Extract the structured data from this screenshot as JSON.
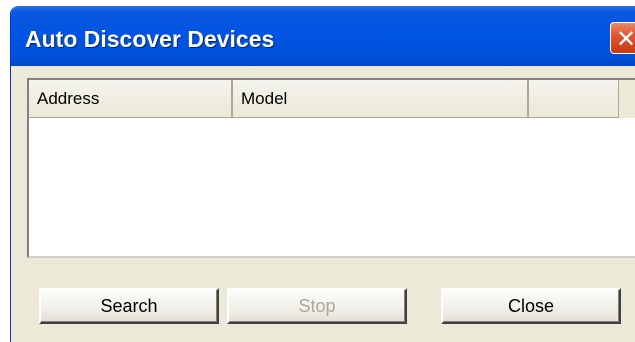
{
  "window": {
    "title": "Auto Discover Devices",
    "close_glyph": "✕"
  },
  "list": {
    "columns": [
      "Address",
      "Model",
      ""
    ],
    "rows": []
  },
  "buttons": {
    "search_label": "Search",
    "stop_label": "Stop",
    "stop_enabled": false,
    "close_label": "Close"
  },
  "colors": {
    "titlebar": "#0054e3",
    "dialog_background": "#ece9d8",
    "close_button": "#e0562f",
    "disabled_text": "#aca899"
  }
}
